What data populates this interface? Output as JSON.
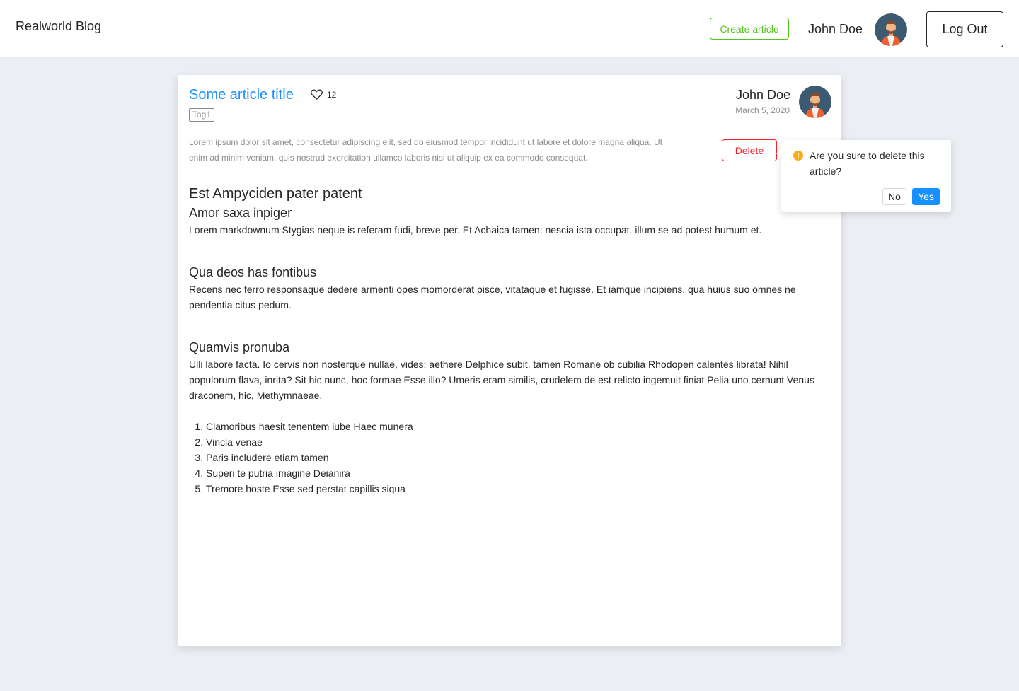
{
  "header": {
    "logo": "Realworld Blog",
    "create_label": "Create article",
    "username": "John Doe",
    "logout_label": "Log Out"
  },
  "article": {
    "title": "Some article title",
    "likes": "12",
    "tags": [
      "Tag1"
    ],
    "excerpt": "Lorem ipsum dolor sit amet, consectetur adipiscing elit, sed do eiusmod tempor incididunt ut labore et dolore magna aliqua. Ut enim ad minim veniam, quis nostrud exercitation ullamco laboris  nisi ut aliquip ex ea commodo consequat.",
    "author": "John Doe",
    "date": "March 5, 2020",
    "delete_label": "Delete",
    "body": {
      "h1": "Est Ampyciden pater patent",
      "sections": [
        {
          "heading": "Amor saxa inpiger",
          "text": "Lorem markdownum Stygias neque is referam fudi, breve per. Et Achaica tamen: nescia ista occupat, illum se ad potest humum et."
        },
        {
          "heading": "Qua deos has fontibus",
          "text": "Recens nec ferro responsaque dedere armenti opes momorderat pisce, vitataque et fugisse. Et iamque incipiens, qua huius suo omnes ne pendentia citus pedum."
        },
        {
          "heading": "Quamvis pronuba",
          "text": "Ulli labore facta. Io cervis non nosterque nullae, vides: aethere Delphice subit, tamen Romane ob cubilia Rhodopen calentes librata! Nihil populorum flava, inrita? Sit hic nunc, hoc formae Esse illo? Umeris eram similis, crudelem de est relicto ingemuit finiat Pelia uno cernunt Venus draconem, hic, Methymnaeae."
        }
      ],
      "list": [
        "Clamoribus haesit tenentem iube Haec munera",
        "Vincla venae",
        "Paris includere etiam tamen",
        "Superi te putria imagine Deianira",
        "Tremore hoste Esse sed perstat capillis siqua"
      ]
    }
  },
  "confirm": {
    "message": "Are you sure to delete this article?",
    "no_label": "No",
    "yes_label": "Yes",
    "icon": "exclamation-circle-icon"
  },
  "colors": {
    "link": "#1890ff",
    "success": "#52c41a",
    "danger": "#f5222d",
    "warning": "#faad14"
  }
}
